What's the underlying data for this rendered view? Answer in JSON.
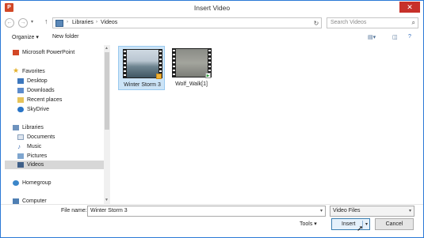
{
  "window": {
    "title": "Insert Video",
    "app_icon_letter": "P",
    "close_glyph": "✕"
  },
  "address_bar": {
    "breadcrumbs": [
      "Libraries",
      "Videos"
    ],
    "separator": "›",
    "search_placeholder": "Search Videos"
  },
  "toolbar": {
    "organize_label": "Organize ▾",
    "new_folder_label": "New folder"
  },
  "nav_pane": {
    "items": [
      {
        "label": "Microsoft PowerPoint",
        "icon": "powerpoint-icon"
      },
      {
        "label": "Favorites",
        "icon": "star-icon"
      },
      {
        "label": "Desktop",
        "icon": "desktop-icon"
      },
      {
        "label": "Downloads",
        "icon": "downloads-icon"
      },
      {
        "label": "Recent places",
        "icon": "recent-places-icon"
      },
      {
        "label": "SkyDrive",
        "icon": "cloud-icon"
      },
      {
        "label": "Libraries",
        "icon": "libraries-icon"
      },
      {
        "label": "Documents",
        "icon": "documents-icon"
      },
      {
        "label": "Music",
        "icon": "music-icon"
      },
      {
        "label": "Pictures",
        "icon": "pictures-icon"
      },
      {
        "label": "Videos",
        "icon": "videos-icon",
        "selected": true
      },
      {
        "label": "Homegroup",
        "icon": "homegroup-icon"
      },
      {
        "label": "Computer",
        "icon": "computer-icon"
      }
    ]
  },
  "files": [
    {
      "name": "Winter Storm 3",
      "selected": true
    },
    {
      "name": "Wolf_Walk[1]",
      "selected": false
    }
  ],
  "footer": {
    "file_name_label": "File name:",
    "file_name_value": "Winter Storm 3",
    "file_type_value": "Video Files",
    "tools_label": "Tools",
    "insert_label": "Insert",
    "cancel_label": "Cancel"
  },
  "colors": {
    "accent_border": "#2b79d6",
    "close_button": "#c7302a",
    "selection_bg": "#cce4f7",
    "powerpoint": "#d24726"
  }
}
